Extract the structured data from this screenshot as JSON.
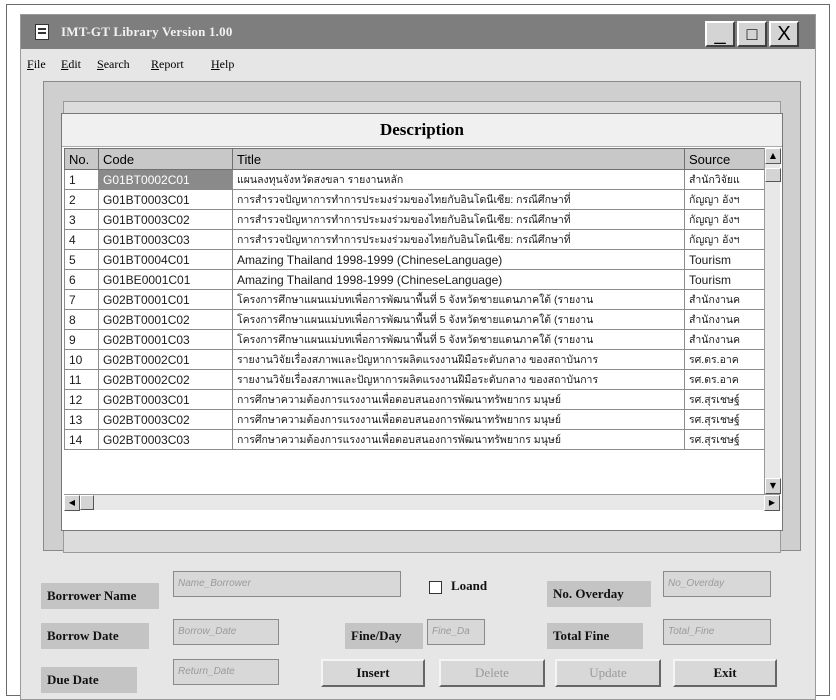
{
  "window": {
    "title": "IMT-GT Library Version 1.00"
  },
  "window_controls": {
    "minimize": "_",
    "maximize": "□",
    "close": "X"
  },
  "menu": [
    {
      "first": "F",
      "rest": "ile"
    },
    {
      "first": "E",
      "rest": "dit"
    },
    {
      "first": "S",
      "rest": "earch"
    },
    {
      "first": "R",
      "rest": "eport"
    },
    {
      "first": "H",
      "rest": "elp"
    }
  ],
  "grid": {
    "title": "Description",
    "columns": [
      "No.",
      "Code",
      "Title",
      "Source"
    ],
    "rows": [
      [
        "1",
        "G01BT0002C01",
        "แผนลงทุนจังหวัดสงขลา รายงานหลัก",
        "สำนักวิจัยแ"
      ],
      [
        "2",
        "G01BT0003C01",
        "การสำรวจปัญหาการทำการประมงร่วมของไทยกับอินโดนีเซีย: กรณีศึกษาที่",
        "กัญญา อังฯ"
      ],
      [
        "3",
        "G01BT0003C02",
        "การสำรวจปัญหาการทำการประมงร่วมของไทยกับอินโดนีเซีย: กรณีศึกษาที่",
        "กัญญา อังฯ"
      ],
      [
        "4",
        "G01BT0003C03",
        "การสำรวจปัญหาการทำการประมงร่วมของไทยกับอินโดนีเซีย: กรณีศึกษาที่",
        "กัญญา อังฯ"
      ],
      [
        "5",
        "G01BT0004C01",
        "Amazing Thailand 1998-1999 (ChineseLanguage)",
        "Tourism"
      ],
      [
        "6",
        "G01BE0001C01",
        "Amazing Thailand 1998-1999 (ChineseLanguage)",
        "Tourism"
      ],
      [
        "7",
        "G02BT0001C01",
        "โครงการศึกษาแผนแม่บทเพื่อการพัฒนาพื้นที่ 5 จังหวัดชายแดนภาคใต้ (รายงาน",
        "สำนักงานค"
      ],
      [
        "8",
        "G02BT0001C02",
        "โครงการศึกษาแผนแม่บทเพื่อการพัฒนาพื้นที่ 5 จังหวัดชายแดนภาคใต้ (รายงาน",
        "สำนักงานค"
      ],
      [
        "9",
        "G02BT0001C03",
        "โครงการศึกษาแผนแม่บทเพื่อการพัฒนาพื้นที่ 5 จังหวัดชายแดนภาคใต้ (รายงาน",
        "สำนักงานค"
      ],
      [
        "10",
        "G02BT0002C01",
        "รายงานวิจัยเรื่องสภาพและปัญหาการผลิตแรงงานฝีมือระดับกลาง ของสถาบันการ",
        "รศ.ดร.อาค"
      ],
      [
        "11",
        "G02BT0002C02",
        "รายงานวิจัยเรื่องสภาพและปัญหาการผลิตแรงงานฝีมือระดับกลาง ของสถาบันการ",
        "รศ.ดร.อาค"
      ],
      [
        "12",
        "G02BT0003C01",
        "การศึกษาความต้องการแรงงานเพื่อตอบสนองการพัฒนาทรัพยากร มนุษย์",
        "รศ.สุรเชษฐ์"
      ],
      [
        "13",
        "G02BT0003C02",
        "การศึกษาความต้องการแรงงานเพื่อตอบสนองการพัฒนาทรัพยากร มนุษย์",
        "รศ.สุรเชษฐ์"
      ],
      [
        "14",
        "G02BT0003C03",
        "การศึกษาความต้องการแรงงานเพื่อตอบสนองการพัฒนาทรัพยากร มนุษย์",
        "รศ.สุรเชษฐ์"
      ]
    ]
  },
  "form": {
    "borrower_name_label": "Borrower Name",
    "borrower_name_placeholder": "Name_Borrower",
    "loand_label": "Loand",
    "overday_label": "No. Overday",
    "overday_placeholder": "No_Overday",
    "borrow_date_label": "Borrow Date",
    "borrow_date_placeholder": "Borrow_Date",
    "fine_day_label": "Fine/Day",
    "fine_day_placeholder": "Fine_Da",
    "total_fine_label": "Total Fine",
    "total_fine_placeholder": "Total_Fine",
    "due_date_label": "Due Date",
    "due_date_placeholder": "Return_Date"
  },
  "buttons": {
    "insert": "Insert",
    "delete": "Delete",
    "update": "Update",
    "exit": "Exit"
  },
  "icons": {
    "scroll_up": "▲",
    "scroll_down": "▼",
    "scroll_left": "◀",
    "scroll_right": "▶"
  }
}
